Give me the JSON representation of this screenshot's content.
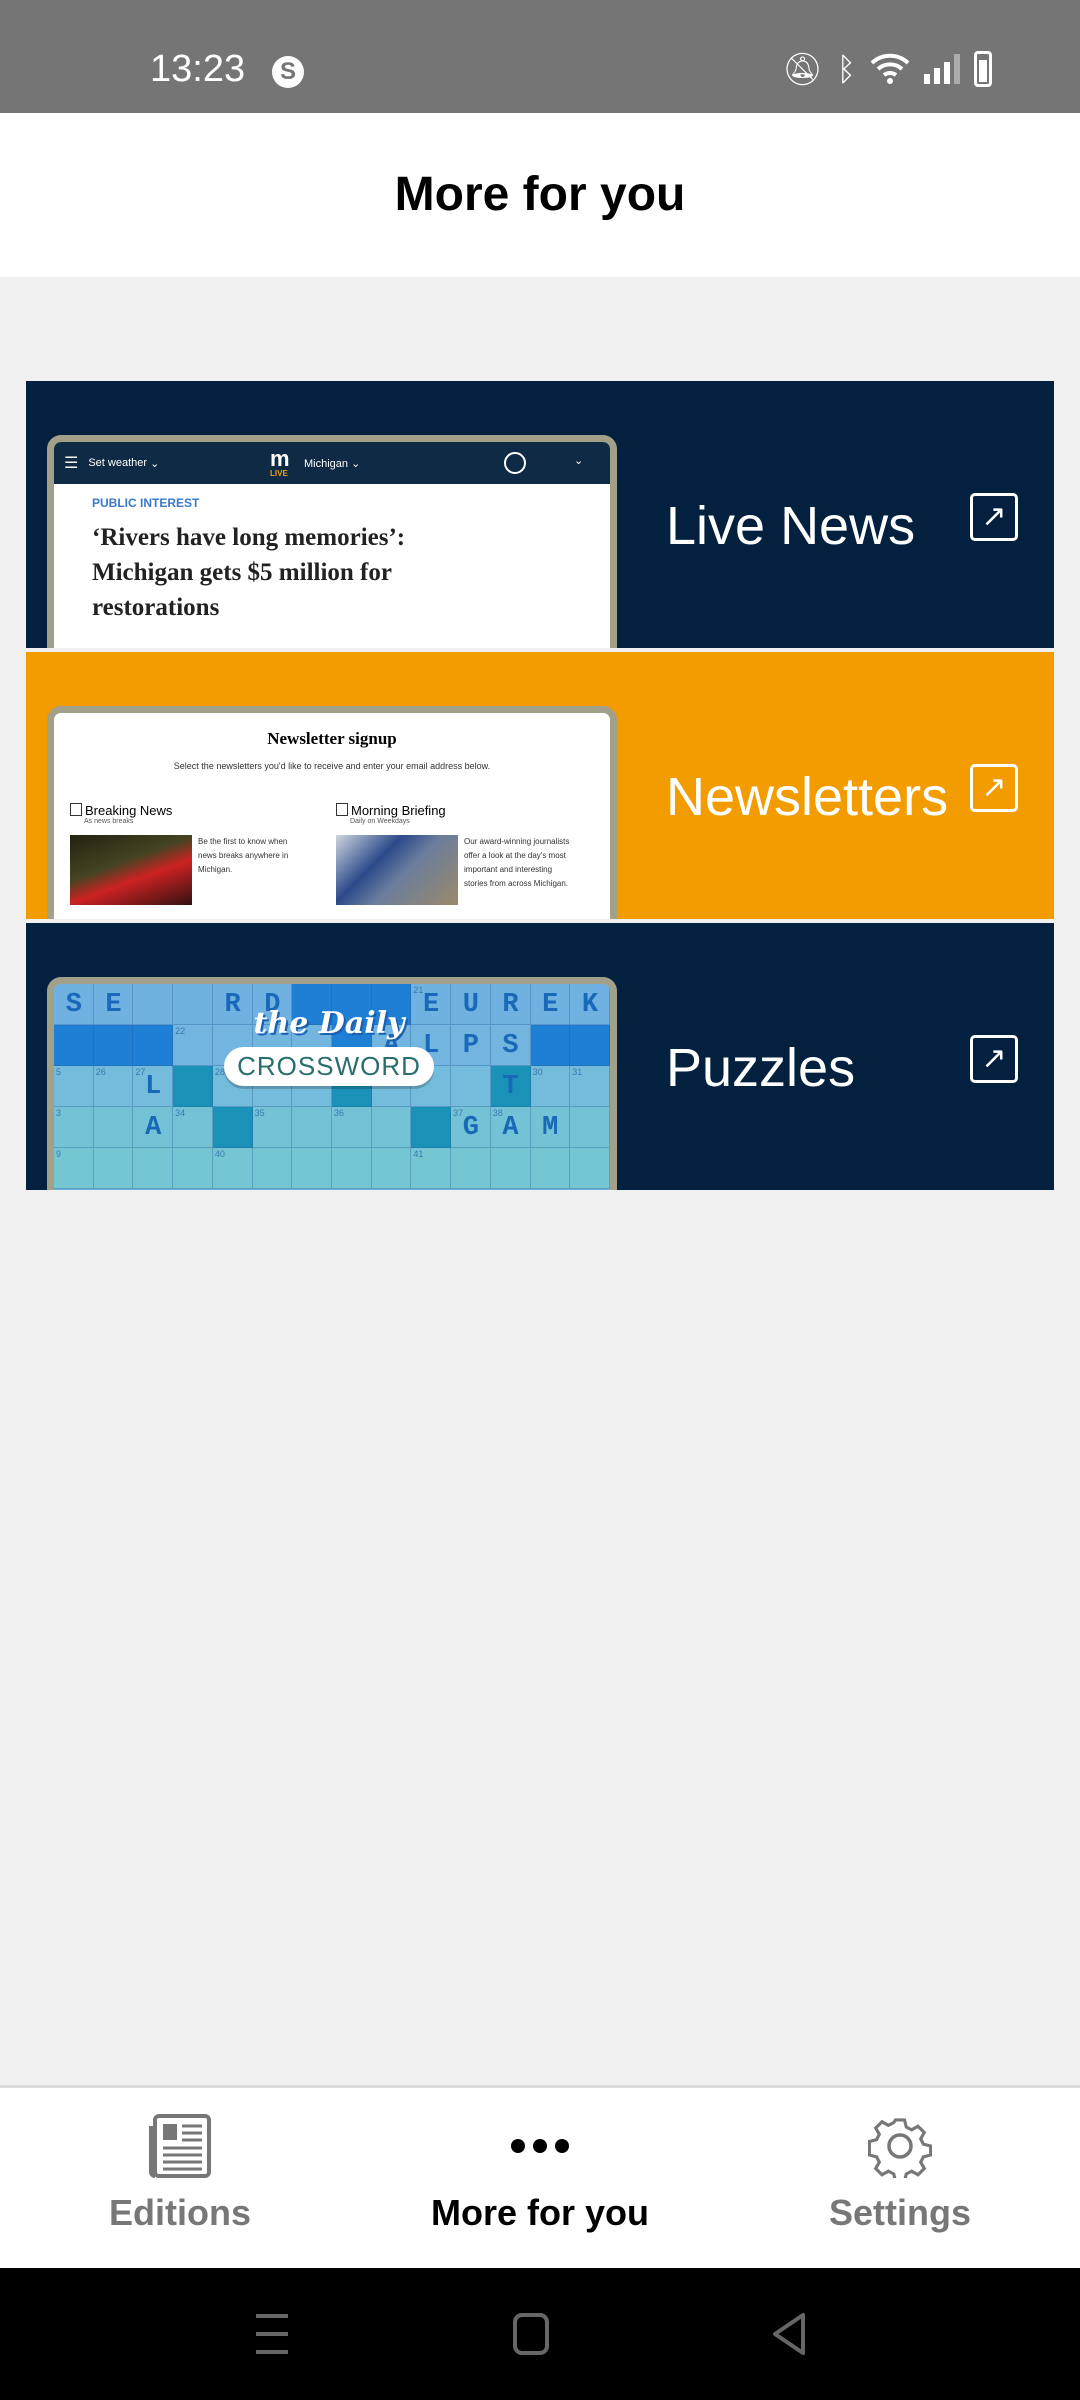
{
  "status_bar": {
    "time": "13:23",
    "app_icon": "s-circle-icon",
    "icons": [
      "mute-icon",
      "bluetooth-icon",
      "wifi-icon",
      "signal-icon",
      "battery-icon"
    ]
  },
  "header": {
    "title": "More for you"
  },
  "cards": [
    {
      "label": "Live News",
      "bg": "#03213f",
      "icon": "external-link-icon",
      "thumb": {
        "weather": "Set weather",
        "logo": "m",
        "logo_sub": "LIVE",
        "region": "Michigan",
        "kicker": "PUBLIC INTEREST",
        "headline": "‘Rivers have long memories’: Michigan gets $5 million for restorations"
      }
    },
    {
      "label": "Newsletters",
      "bg": "#f39c00",
      "icon": "external-link-icon",
      "thumb": {
        "title": "Newsletter signup",
        "subtitle": "Select the newsletters you'd like to receive and enter your email address below.",
        "items": [
          {
            "name": "Breaking News",
            "frequency": "As news breaks",
            "description": "Be the first to know when news breaks anywhere in Michigan."
          },
          {
            "name": "Morning Briefing",
            "frequency": "Daily on Weekdays",
            "description": "Our award-winning journalists offer a look at the day's most important and interesting stories from across Michigan."
          }
        ]
      }
    },
    {
      "label": "Puzzles",
      "bg": "#03213f",
      "icon": "external-link-icon",
      "thumb": {
        "logo_line1": "the Daily",
        "logo_line2": "CROSSWORD",
        "rows": [
          "SE  RD   EUREK",
          "        ALPS  ",
          "  L        T  ",
          "  A       GAM",
          "              "
        ]
      }
    }
  ],
  "bottom_nav": {
    "items": [
      {
        "label": "Editions",
        "icon": "newspaper-icon",
        "active": false
      },
      {
        "label": "More for you",
        "icon": "more-dots-icon",
        "active": true
      },
      {
        "label": "Settings",
        "icon": "gear-icon",
        "active": false
      }
    ]
  },
  "system_nav": [
    "recents-icon",
    "home-icon",
    "back-icon"
  ]
}
